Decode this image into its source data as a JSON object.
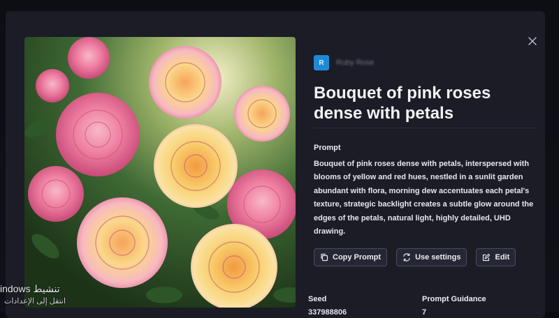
{
  "author": {
    "avatar_letter": "R",
    "avatar_color": "#1e8ad6",
    "name": "Ruby Rose"
  },
  "close_icon": "close-icon",
  "image": {
    "alt": "Bouquet of pink roses"
  },
  "title": "Bouquet of pink roses dense with petals",
  "prompt": {
    "label": "Prompt",
    "text": "Bouquet of pink roses dense with petals, interspersed with blooms of yellow and red hues, nestled in a sunlit garden abundant with flora, morning dew accentuates each petal's texture, strategic backlight creates a subtle glow around the edges of the petals, natural light, highly detailed, UHD drawing."
  },
  "actions": {
    "copy_prompt": "Copy Prompt",
    "use_settings": "Use settings",
    "edit": "Edit"
  },
  "meta": {
    "seed_label": "Seed",
    "seed_value": "337988806",
    "guidance_label": "Prompt Guidance",
    "guidance_value": "7"
  },
  "os_overlay": {
    "line1": "indows تنشيط",
    "line2": "انتقل إلى الإعدادات"
  }
}
